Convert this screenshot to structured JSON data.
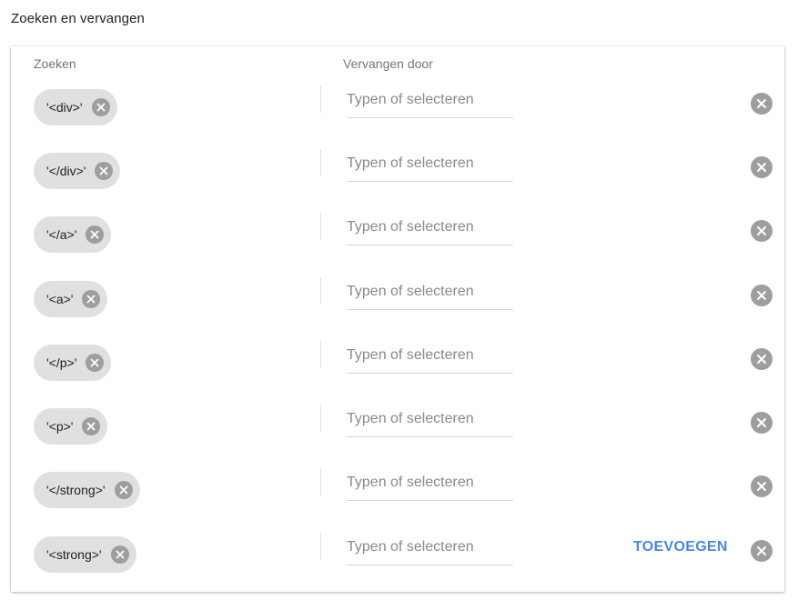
{
  "section": {
    "title": "Zoeken en vervangen"
  },
  "headers": {
    "search": "Zoeken",
    "replace": "Vervangen door"
  },
  "rows": [
    {
      "search_token": "'<div>'",
      "replace_placeholder": "Typen of selecteren",
      "replace_value": ""
    },
    {
      "search_token": "'</div>'",
      "replace_placeholder": "Typen of selecteren",
      "replace_value": ""
    },
    {
      "search_token": "'</a>'",
      "replace_placeholder": "Typen of selecteren",
      "replace_value": ""
    },
    {
      "search_token": "'<a>'",
      "replace_placeholder": "Typen of selecteren",
      "replace_value": ""
    },
    {
      "search_token": "'</p>'",
      "replace_placeholder": "Typen of selecteren",
      "replace_value": ""
    },
    {
      "search_token": "'<p>'",
      "replace_placeholder": "Typen of selecteren",
      "replace_value": ""
    },
    {
      "search_token": "'</strong>'",
      "replace_placeholder": "Typen of selecteren",
      "replace_value": ""
    },
    {
      "search_token": "'<strong>'",
      "replace_placeholder": "Typen of selecteren",
      "replace_value": ""
    }
  ],
  "actions": {
    "add_label": "TOEVOEGEN"
  },
  "icons": {
    "chip_remove": "cancel-icon",
    "row_remove": "cancel-icon"
  },
  "colors": {
    "accent": "#4a86e8",
    "chip_bg": "#e0e0e0",
    "icon_gray": "#9e9e9e"
  }
}
